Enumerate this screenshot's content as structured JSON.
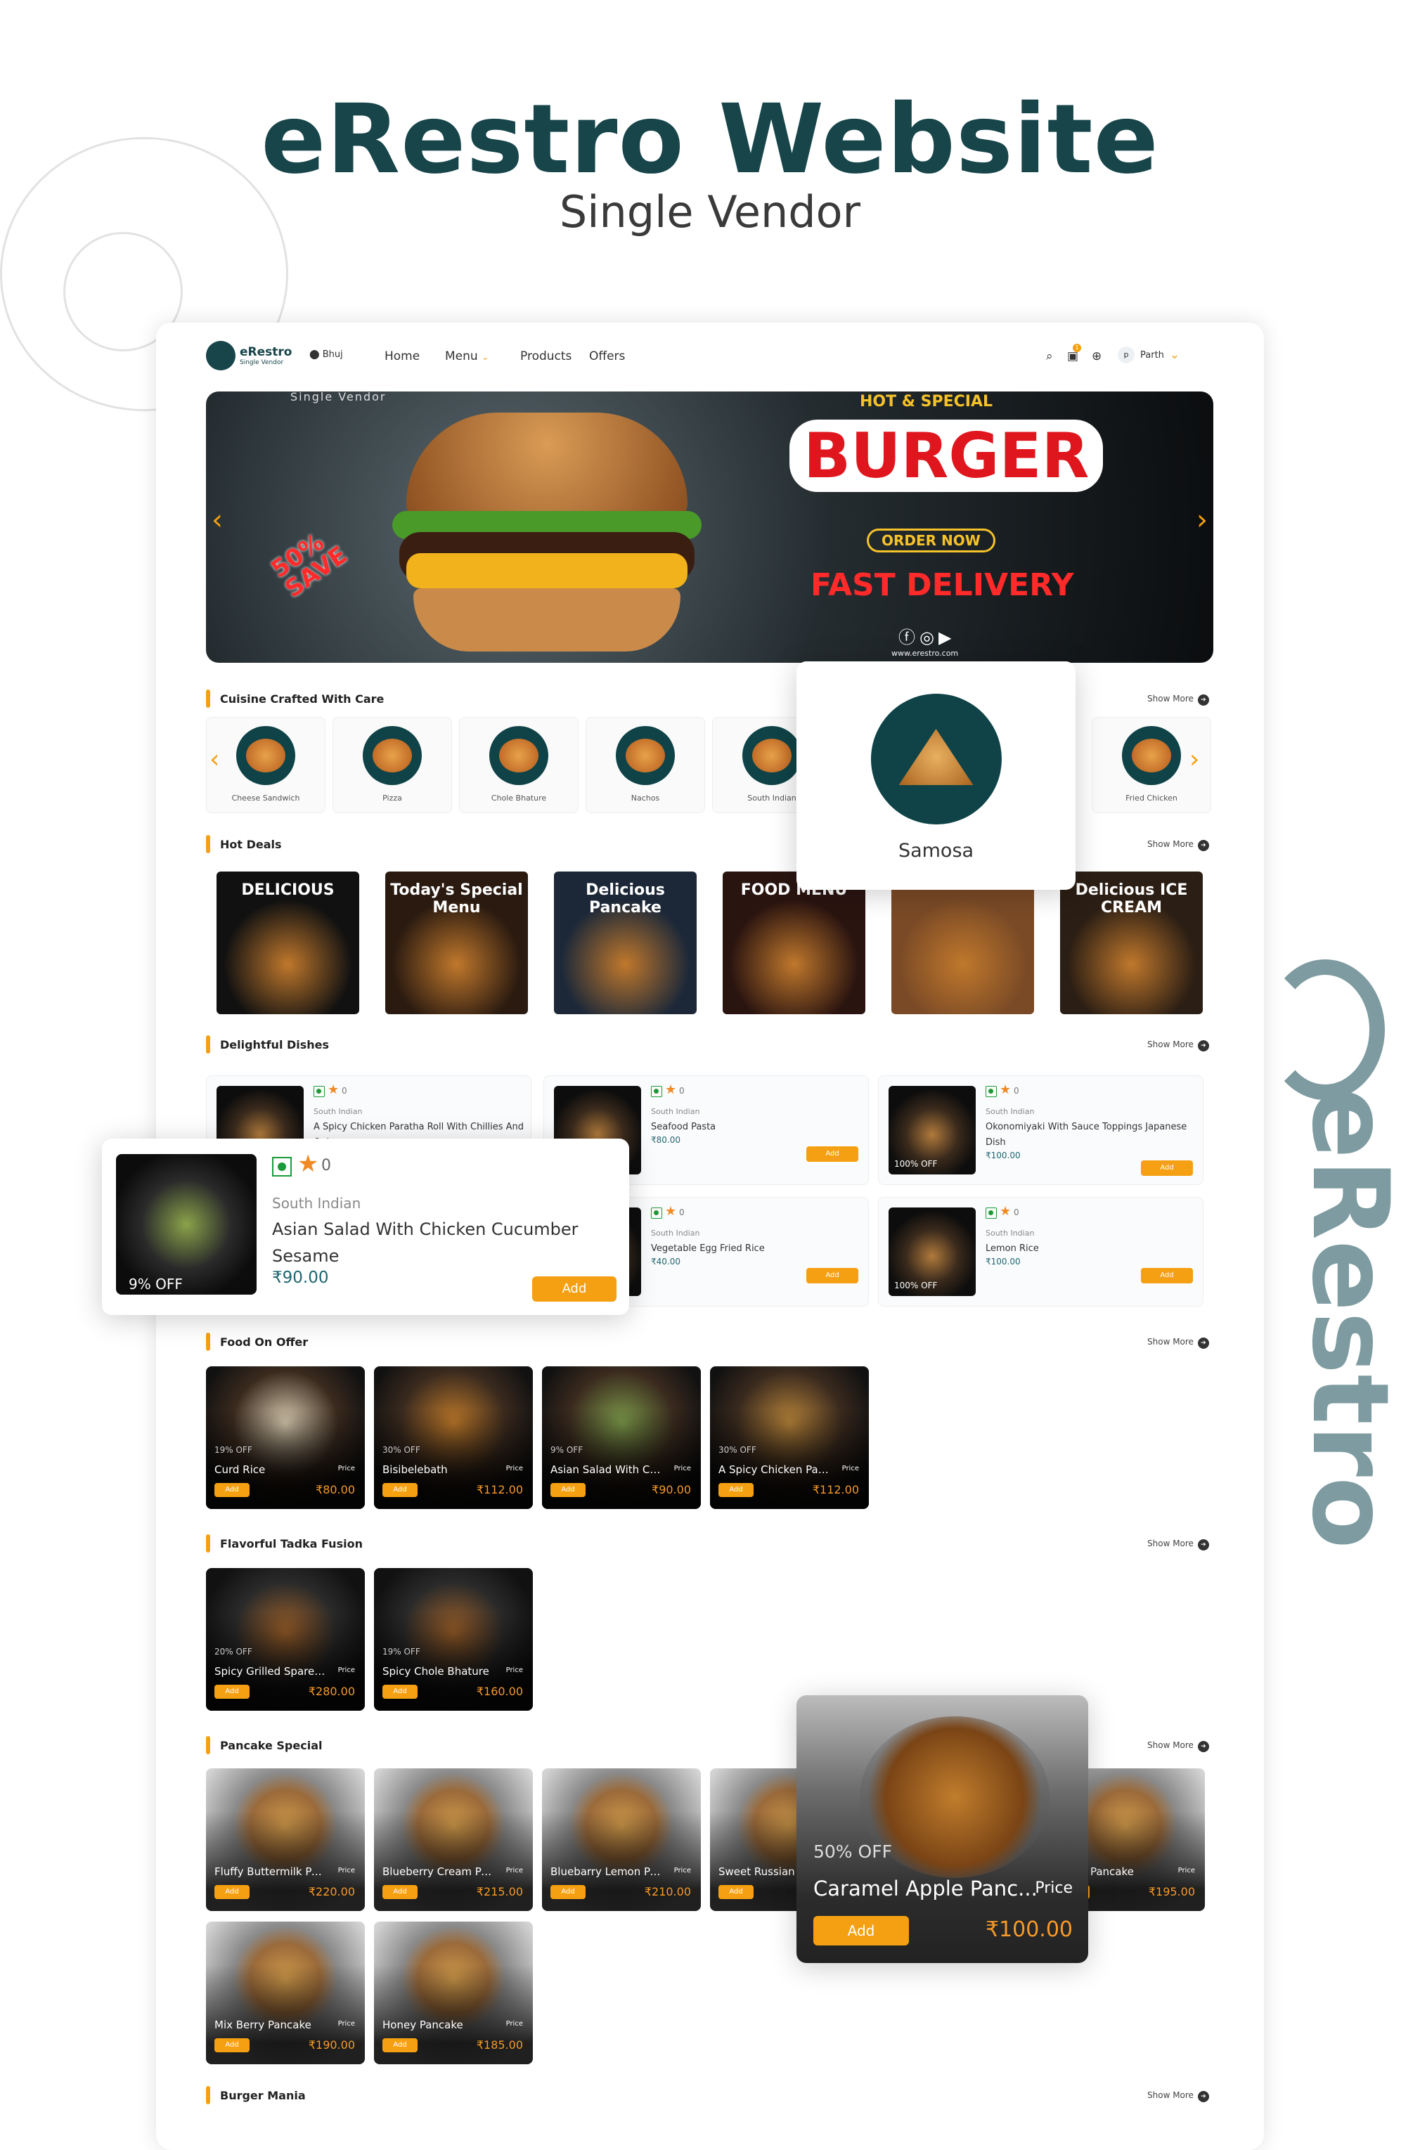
{
  "hero": {
    "title": "eRestro Website",
    "subtitle": "Single Vendor"
  },
  "watermark": {
    "text": "eRestro"
  },
  "header": {
    "logo_name": "eRestro",
    "logo_tag": "Single Vendor",
    "location": "Bhuj",
    "nav": [
      "Home",
      "Menu",
      "Products",
      "Offers"
    ],
    "cart_count": "1",
    "avatar_letter": "p",
    "user": "Parth"
  },
  "banner": {
    "corner": "Single Vendor",
    "hot": "HOT & SPECIAL",
    "headline": "BURGER",
    "cta": "ORDER NOW",
    "tagline": "FAST DELIVERY",
    "save": "50% SAVE",
    "url": "www.erestro.com"
  },
  "colors": {
    "accent": "#f5a012",
    "brand": "#17454a",
    "price": "#1e6670"
  },
  "show_more": "Show More",
  "sections": {
    "cuisine": "Cuisine Crafted With Care",
    "hot": "Hot Deals",
    "dishes": "Delightful Dishes",
    "offer": "Food On Offer",
    "tadka": "Flavorful Tadka Fusion",
    "pancake": "Pancake Special",
    "burger": "Burger Mania"
  },
  "categories": [
    "Cheese Sandwich",
    "Pizza",
    "Chole Bhature",
    "Nachos",
    "South Indian",
    "",
    "",
    "Fried Chicken"
  ],
  "category_popup": "Samosa",
  "hot_deals": [
    "DELICIOUS",
    "Today's Special Menu",
    "Delicious Pancake",
    "FOOD MENU",
    "",
    "Delicious ICE CREAM"
  ],
  "dishes": [
    {
      "cuisine": "South Indian",
      "name": "A Spicy Chicken Paratha Roll With Chillies And Onion",
      "price": "",
      "rating": "0",
      "off": ""
    },
    {
      "cuisine": "South Indian",
      "name": "Seafood Pasta",
      "price": "₹80.00",
      "rating": "0",
      "off": ""
    },
    {
      "cuisine": "South Indian",
      "name": "Okonomiyaki With Sauce Toppings Japanese Dish",
      "price": "₹100.00",
      "rating": "0",
      "off": "100% OFF"
    },
    {
      "cuisine": "",
      "name": "",
      "price": "",
      "rating": "",
      "off": ""
    },
    {
      "cuisine": "South Indian",
      "name": "Vegetable Egg Fried Rice",
      "price": "₹40.00",
      "rating": "0",
      "off": ""
    },
    {
      "cuisine": "South Indian",
      "name": "Lemon Rice",
      "price": "₹100.00",
      "rating": "0",
      "off": "100% OFF"
    }
  ],
  "dish_popup": {
    "cuisine": "South Indian",
    "name": "Asian Salad With Chicken Cucumber Sesame",
    "price": "₹90.00",
    "rating": "0",
    "off": "9% OFF",
    "add": "Add"
  },
  "add_label": "Add",
  "price_label": "Price",
  "food_on_offer": [
    {
      "off": "19% OFF",
      "name": "Curd Rice",
      "price": "₹80.00"
    },
    {
      "off": "30% OFF",
      "name": "Bisibelebath",
      "price": "₹112.00"
    },
    {
      "off": "9% OFF",
      "name": "Asian Salad With Chi...",
      "price": "₹90.00"
    },
    {
      "off": "30% OFF",
      "name": "A Spicy Chicken Para...",
      "price": "₹112.00"
    }
  ],
  "tadka": [
    {
      "off": "20% OFF",
      "name": "Spicy Grilled Spare R...",
      "price": "₹280.00"
    },
    {
      "off": "19% OFF",
      "name": "Spicy Chole Bhature",
      "price": "₹160.00"
    }
  ],
  "pancakes": [
    {
      "off": "",
      "name": "Fluffy Buttermilk Pa...",
      "price": "₹220.00"
    },
    {
      "off": "",
      "name": "Blueberry Cream Pa...",
      "price": "₹215.00"
    },
    {
      "off": "",
      "name": "Bluebarry Lemon Pa...",
      "price": "₹210.00"
    },
    {
      "off": "",
      "name": "Sweet Russian",
      "price": ""
    },
    {
      "off": "",
      "name": "",
      "price": ""
    },
    {
      "off": "",
      "name": "Flavor Pancake",
      "price": "₹195.00"
    },
    {
      "off": "",
      "name": "Mix Berry Pancake",
      "price": "₹190.00"
    },
    {
      "off": "",
      "name": "Honey Pancake",
      "price": "₹185.00"
    }
  ],
  "pancake_popup": {
    "off": "50% OFF",
    "name": "Caramel Apple Panc...",
    "price": "₹100.00",
    "price_label": "Price",
    "add": "Add"
  }
}
